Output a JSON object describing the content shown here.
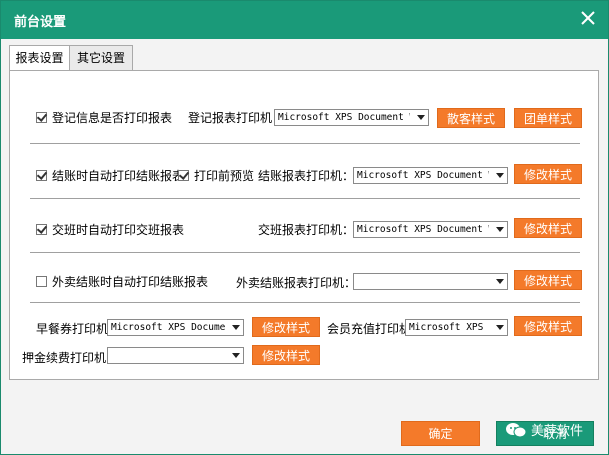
{
  "window": {
    "title": "前台设置"
  },
  "tabs": [
    {
      "label": "报表设置",
      "active": true
    },
    {
      "label": "其它设置",
      "active": false
    }
  ],
  "section1": {
    "checkbox": {
      "label": "登记信息是否打印报表",
      "checked": true
    },
    "printer_label": "登记报表打印机",
    "printer_value": "Microsoft XPS Document W:",
    "button1": "散客样式",
    "button2": "团单样式"
  },
  "section2": {
    "checkbox1": {
      "label": "结账时自动打印结账报表",
      "checked": true
    },
    "checkbox2": {
      "label": "打印前预览",
      "checked": true
    },
    "printer_label": "结账报表打印机：",
    "printer_value": "Microsoft XPS Document W:",
    "button": "修改样式"
  },
  "section3": {
    "checkbox": {
      "label": "交班时自动打印交班报表",
      "checked": true
    },
    "printer_label": "交班报表打印机：",
    "printer_value": "Microsoft XPS Document W:",
    "button": "修改样式"
  },
  "section4": {
    "checkbox": {
      "label": "外卖结账时自动打印结账报表",
      "checked": false
    },
    "printer_label": "外卖结账报表打印机：",
    "printer_value": "",
    "button": "修改样式"
  },
  "section5": {
    "breakfast_label": "早餐券打印机",
    "breakfast_value": "Microsoft XPS Documen",
    "breakfast_button": "修改样式",
    "member_label": "会员充值打印机",
    "member_value": "Microsoft XPS D",
    "member_button": "修改样式",
    "deposit_label": "押金续费打印机",
    "deposit_value": "",
    "deposit_button": "修改样式"
  },
  "footer": {
    "confirm": "确定",
    "cancel": "取消",
    "watermark": "美萍软件"
  },
  "colors": {
    "titlebar": "#1a9a79",
    "accent_button": "#f47a2a",
    "cancel_button": "#1a9a79"
  }
}
